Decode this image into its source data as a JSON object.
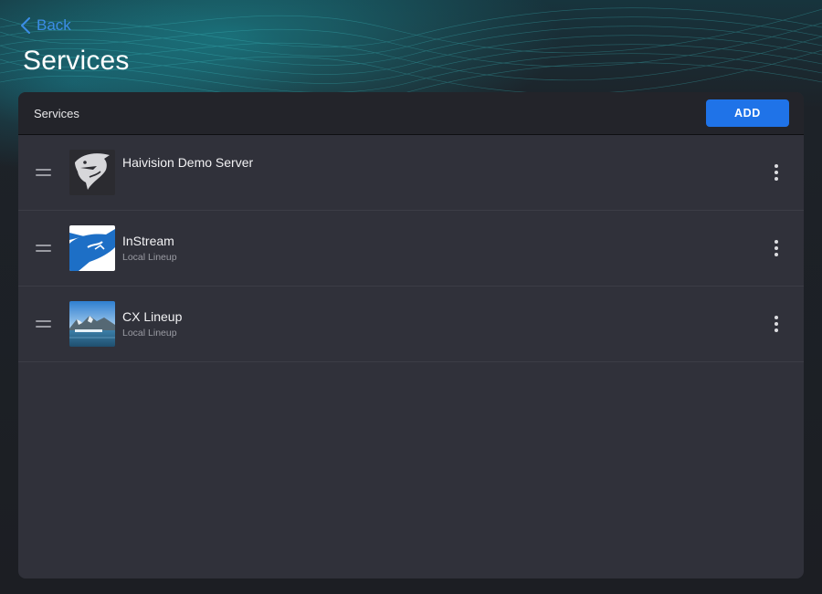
{
  "nav": {
    "back_label": "Back"
  },
  "page": {
    "title": "Services"
  },
  "panel": {
    "title": "Services",
    "add_label": "ADD"
  },
  "services": [
    {
      "name": "Haivision Demo Server",
      "subtitle": "",
      "icon": "shark-logo-dark"
    },
    {
      "name": "InStream",
      "subtitle": "Local Lineup",
      "icon": "shark-logo-blue"
    },
    {
      "name": "CX Lineup",
      "subtitle": "Local Lineup",
      "icon": "glacier-photo"
    }
  ],
  "colors": {
    "accent": "#1f73e8",
    "link": "#3b8de6",
    "panel": "#30313a",
    "panel_header": "#23242a"
  }
}
